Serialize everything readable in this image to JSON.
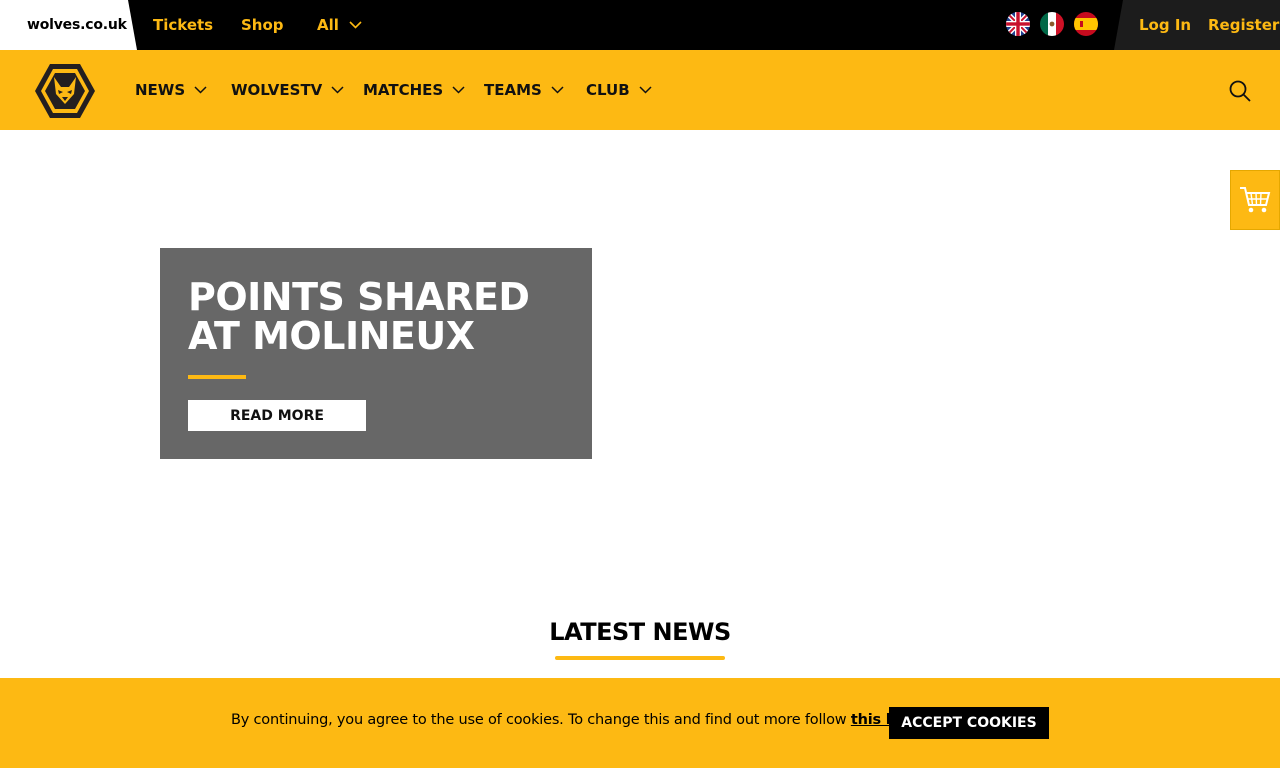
{
  "topbar": {
    "site_label": "wolves.co.uk",
    "links": [
      "Tickets",
      "Shop",
      "All"
    ],
    "flags": [
      "uk-flag-icon",
      "mexico-flag-icon",
      "spain-flag-icon"
    ],
    "login_label": "Log In",
    "register_label": "Register"
  },
  "nav": {
    "items": [
      "NEWS",
      "WOLVESTV",
      "MATCHES",
      "TEAMS",
      "CLUB"
    ],
    "logo_icon": "wolves-crest-icon",
    "search_icon": "search-icon"
  },
  "cart": {
    "icon": "shopping-cart-icon"
  },
  "hero": {
    "title": "POINTS SHARED AT MOLINEUX",
    "cta_label": "READ MORE"
  },
  "latest": {
    "heading": "LATEST NEWS"
  },
  "cookie": {
    "text": "By continuing, you agree to the use of cookies. To change this and find out more follow ",
    "link_label": "this link",
    "accept_label": "ACCEPT COOKIES"
  },
  "colors": {
    "brand_gold": "#fdb913",
    "black": "#000000",
    "hero_grey": "#676767"
  }
}
